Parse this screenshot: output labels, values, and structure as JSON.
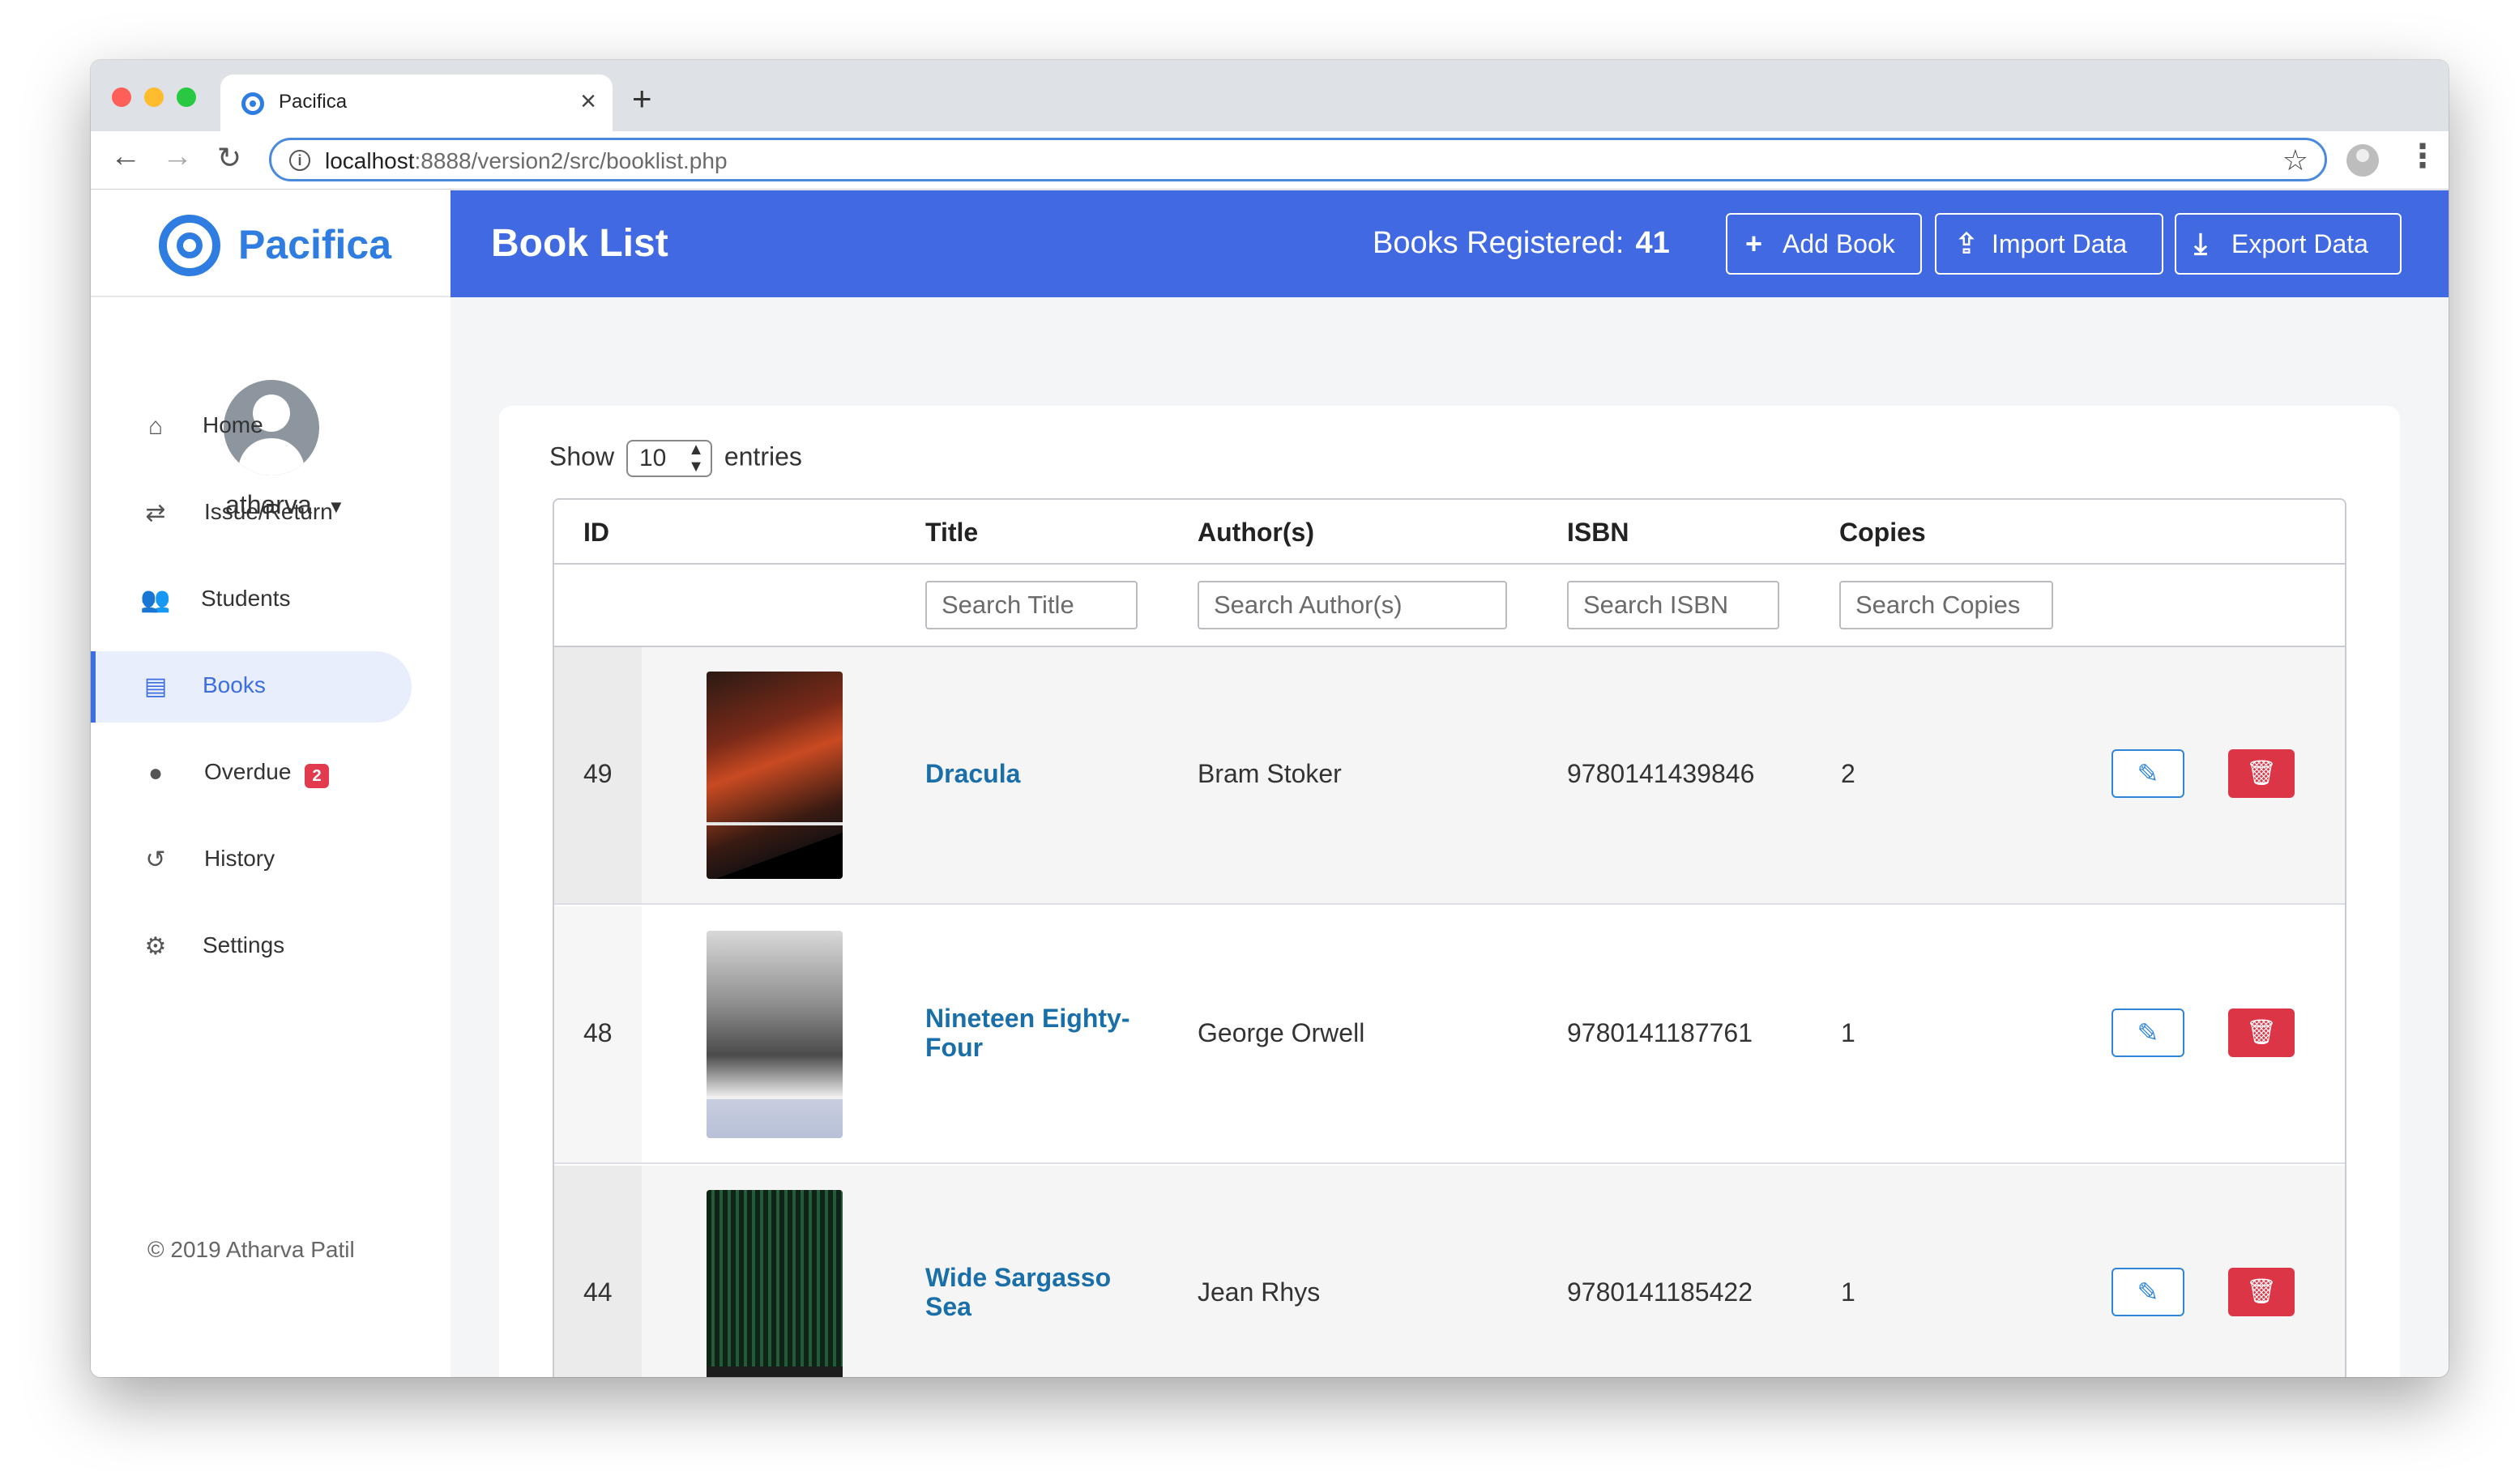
{
  "browser": {
    "tab_title": "Pacifica",
    "url_host": "localhost",
    "url_rest": ":8888/version2/src/booklist.php"
  },
  "sidebar": {
    "brand": "Pacifica",
    "username": "atharva",
    "items": [
      {
        "label": "Home",
        "icon": "home-icon"
      },
      {
        "label": "Issue/Return",
        "icon": "exchange-icon"
      },
      {
        "label": "Students",
        "icon": "users-icon"
      },
      {
        "label": "Books",
        "icon": "book-icon",
        "active": true
      },
      {
        "label": "Overdue",
        "icon": "alert-icon",
        "badge": "2"
      },
      {
        "label": "History",
        "icon": "history-icon"
      },
      {
        "label": "Settings",
        "icon": "gear-icon"
      }
    ],
    "copyright": "© 2019 Atharva Patil"
  },
  "header": {
    "title": "Book List",
    "count_label": "Books Registered:",
    "count_value": "41",
    "add_label": "Add Book",
    "import_label": "Import Data",
    "export_label": "Export Data"
  },
  "table_controls": {
    "show": "Show",
    "entries_value": "10",
    "entries": "entries"
  },
  "table": {
    "columns": [
      "ID",
      "Title",
      "Author(s)",
      "ISBN",
      "Copies"
    ],
    "search_placeholders": {
      "title": "Search Title",
      "author": "Search Author(s)",
      "isbn": "Search ISBN",
      "copies": "Search Copies"
    },
    "rows": [
      {
        "id": "49",
        "title": "Dracula",
        "author": "Bram Stoker",
        "isbn": "9780141439846",
        "copies": "2"
      },
      {
        "id": "48",
        "title": "Nineteen Eighty-Four",
        "author": "George Orwell",
        "isbn": "9780141187761",
        "copies": "1"
      },
      {
        "id": "44",
        "title": "Wide Sargasso Sea",
        "author": "Jean Rhys",
        "isbn": "9780141185422",
        "copies": "1"
      }
    ]
  },
  "colors": {
    "brand": "#2f7de1",
    "header": "#4169e1",
    "danger": "#dc3545",
    "link": "#1a6fa8"
  }
}
